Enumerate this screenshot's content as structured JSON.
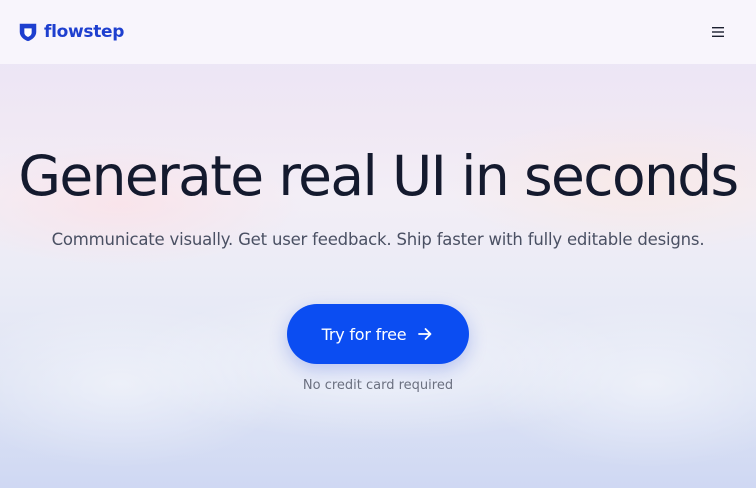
{
  "header": {
    "brand_name": "flowstep",
    "logo_icon": "flowstep-logo-icon",
    "menu_icon": "hamburger-menu-icon"
  },
  "hero": {
    "title": "Generate real UI in seconds",
    "subtitle": "Communicate visually. Get user feedback. Ship faster with fully editable designs.",
    "cta_label": "Try for free",
    "cta_icon": "arrow-right-icon",
    "note": "No credit card required"
  },
  "colors": {
    "brand": "#1e3fcf",
    "cta_background": "#0b4df2",
    "title_text": "#141a2e"
  }
}
